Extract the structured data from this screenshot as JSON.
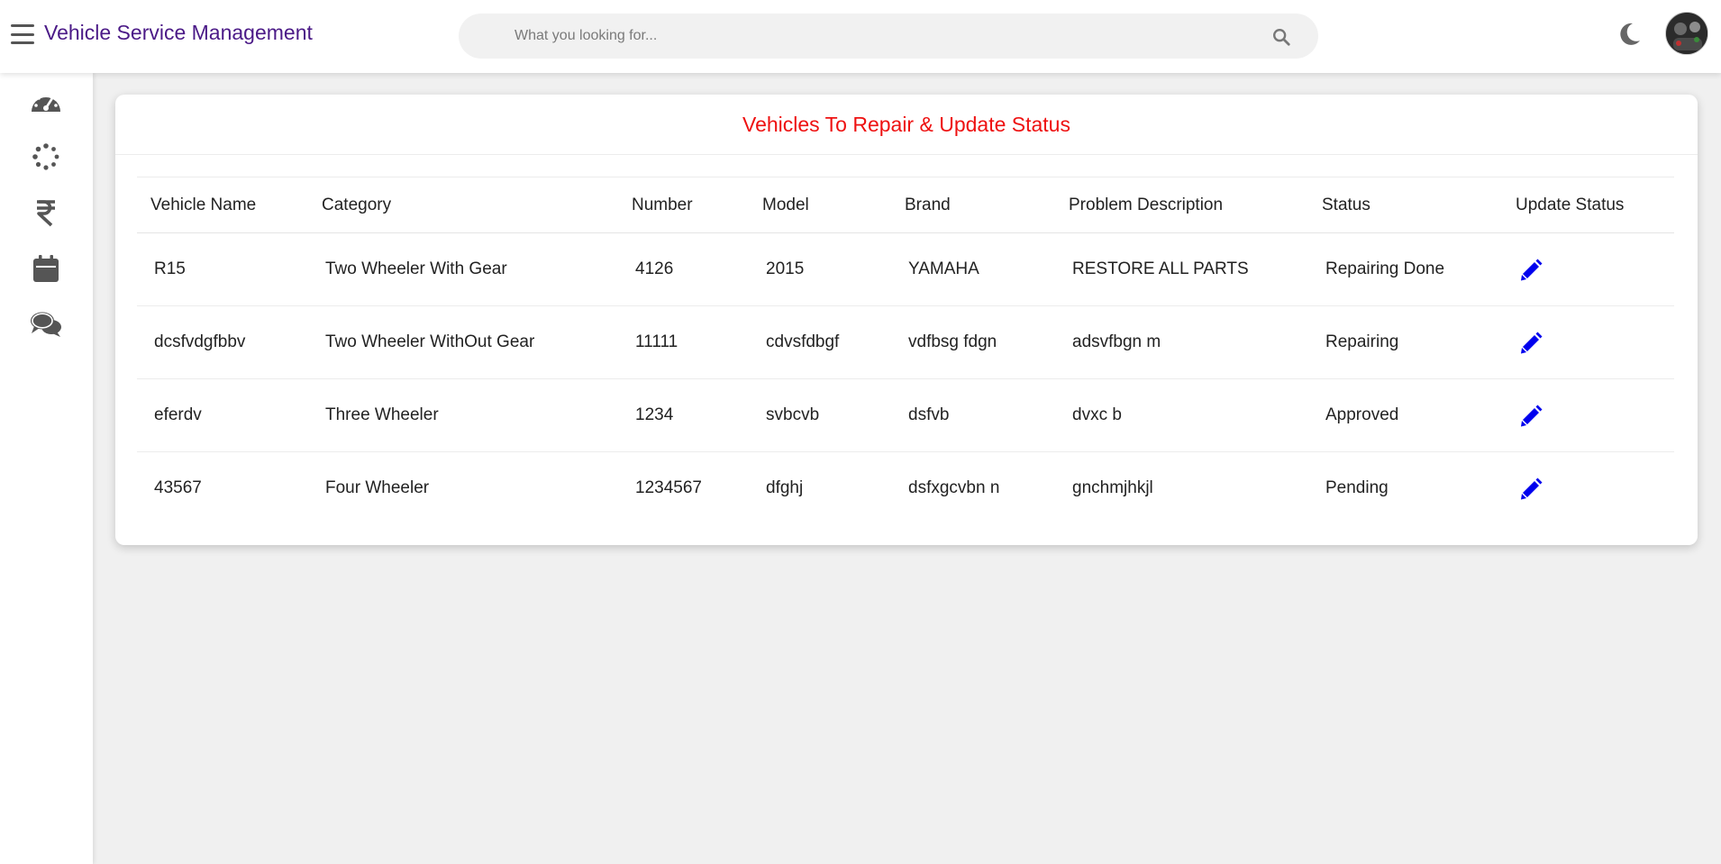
{
  "header": {
    "title": "Vehicle Service Management",
    "search_placeholder": "What you looking for...",
    "search_value": ""
  },
  "sidebar": {
    "items": [
      {
        "icon": "dashboard-gauge-icon"
      },
      {
        "icon": "spinner-icon"
      },
      {
        "icon": "rupee-icon"
      },
      {
        "icon": "calendar-icon"
      },
      {
        "icon": "chat-icon"
      }
    ]
  },
  "card": {
    "title": "Vehicles To Repair & Update Status",
    "columns": [
      "Vehicle Name",
      "Category",
      "Number",
      "Model",
      "Brand",
      "Problem Description",
      "Status",
      "Update Status"
    ],
    "rows": [
      {
        "vehicle_name": "R15",
        "category": "Two Wheeler With Gear",
        "number": "4126",
        "model": "2015",
        "brand": "YAMAHA",
        "problem": "RESTORE ALL PARTS",
        "status": "Repairing Done"
      },
      {
        "vehicle_name": "dcsfvdgfbbv",
        "category": "Two Wheeler WithOut Gear",
        "number": "11111",
        "model": "cdvsfdbgf",
        "brand": "vdfbsg fdgn",
        "problem": "adsvfbgn m",
        "status": "Repairing"
      },
      {
        "vehicle_name": "eferdv",
        "category": "Three Wheeler",
        "number": "1234",
        "model": "svbcvb",
        "brand": "dsfvb",
        "problem": "dvxc b",
        "status": "Approved"
      },
      {
        "vehicle_name": "43567",
        "category": "Four Wheeler",
        "number": "1234567",
        "model": "dfghj",
        "brand": "dsfxgcvbn n",
        "problem": "gnchmjhkjl",
        "status": "Pending"
      }
    ]
  },
  "colors": {
    "brand_purple": "#4b1a87",
    "title_red": "#ee1111",
    "edit_blue": "#0000ee",
    "icon_gray": "#555555"
  }
}
